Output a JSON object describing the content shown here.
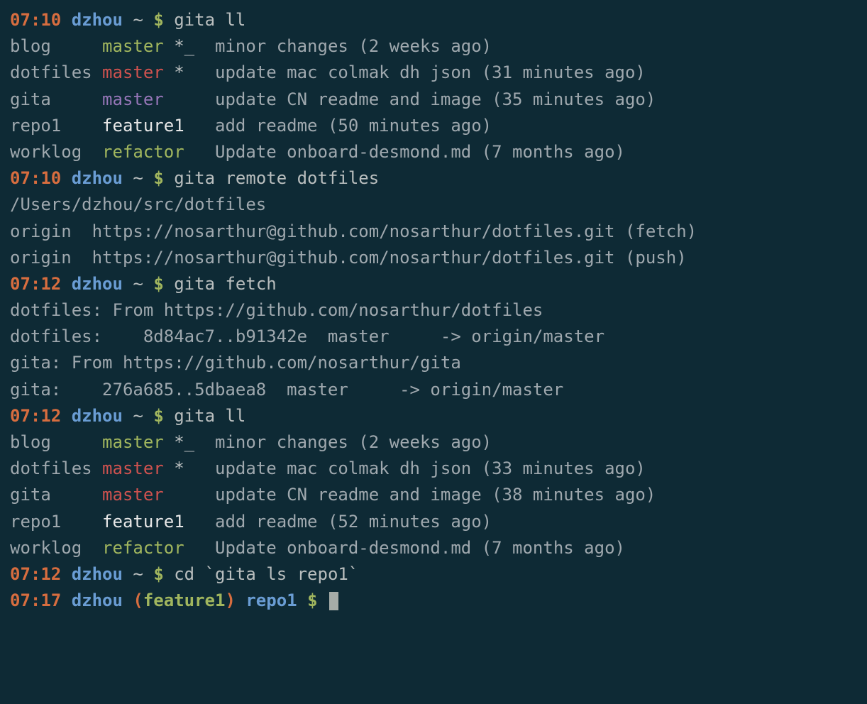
{
  "cmd1": {
    "prompt": {
      "time": "07:10",
      "user": "dzhou",
      "tilde": "~",
      "dollar": "$"
    },
    "command": "gita ll",
    "rows": [
      {
        "repo": "blog    ",
        "branch": " master",
        "branchColor": "branch-green",
        "flags": " *_ ",
        "msg": " minor changes (2 weeks ago)"
      },
      {
        "repo": "dotfiles",
        "branch": " master",
        "branchColor": "branch-red",
        "flags": " *  ",
        "msg": " update mac colmak dh json (31 minutes ago)"
      },
      {
        "repo": "gita    ",
        "branch": " master",
        "branchColor": "branch-purple",
        "flags": "    ",
        "msg": " update CN readme and image (35 minutes ago)"
      },
      {
        "repo": "repo1   ",
        "branch": " feature1",
        "branchColor": "branch-white",
        "flags": "  ",
        "msg": " add readme (50 minutes ago)"
      },
      {
        "repo": "worklog ",
        "branch": " refactor",
        "branchColor": "branch-yellow",
        "flags": "  ",
        "msg": " Update onboard-desmond.md (7 months ago)"
      }
    ]
  },
  "cmd2": {
    "prompt": {
      "time": "07:10",
      "user": "dzhou",
      "tilde": "~",
      "dollar": "$"
    },
    "command": "gita remote dotfiles",
    "output": [
      "/Users/dzhou/src/dotfiles",
      "origin  https://nosarthur@github.com/nosarthur/dotfiles.git (fetch)",
      "origin  https://nosarthur@github.com/nosarthur/dotfiles.git (push)"
    ]
  },
  "cmd3": {
    "prompt": {
      "time": "07:12",
      "user": "dzhou",
      "tilde": "~",
      "dollar": "$"
    },
    "command": "gita fetch",
    "output": [
      "dotfiles: From https://github.com/nosarthur/dotfiles",
      "dotfiles:    8d84ac7..b91342e  master     -> origin/master",
      "",
      "gita: From https://github.com/nosarthur/gita",
      "gita:    276a685..5dbaea8  master     -> origin/master",
      ""
    ]
  },
  "cmd4": {
    "prompt": {
      "time": "07:12",
      "user": "dzhou",
      "tilde": "~",
      "dollar": "$"
    },
    "command": "gita ll",
    "rows": [
      {
        "repo": "blog    ",
        "branch": " master",
        "branchColor": "branch-green",
        "flags": " *_ ",
        "msg": " minor changes (2 weeks ago)"
      },
      {
        "repo": "dotfiles",
        "branch": " master",
        "branchColor": "branch-red",
        "flags": " *  ",
        "msg": " update mac colmak dh json (33 minutes ago)"
      },
      {
        "repo": "gita    ",
        "branch": " master",
        "branchColor": "branch-red",
        "flags": "    ",
        "msg": " update CN readme and image (38 minutes ago)"
      },
      {
        "repo": "repo1   ",
        "branch": " feature1",
        "branchColor": "branch-white",
        "flags": "  ",
        "msg": " add readme (52 minutes ago)"
      },
      {
        "repo": "worklog ",
        "branch": " refactor",
        "branchColor": "branch-yellow",
        "flags": "  ",
        "msg": " Update onboard-desmond.md (7 months ago)"
      }
    ]
  },
  "cmd5": {
    "prompt": {
      "time": "07:12",
      "user": "dzhou",
      "tilde": "~",
      "dollar": "$"
    },
    "command": "cd `gita ls repo1`"
  },
  "cmd6": {
    "prompt": {
      "time": "07:17",
      "user": "dzhou",
      "paren_open": "(",
      "branch": "feature1",
      "paren_close": ")",
      "dir": "repo1",
      "dollar": "$"
    }
  }
}
